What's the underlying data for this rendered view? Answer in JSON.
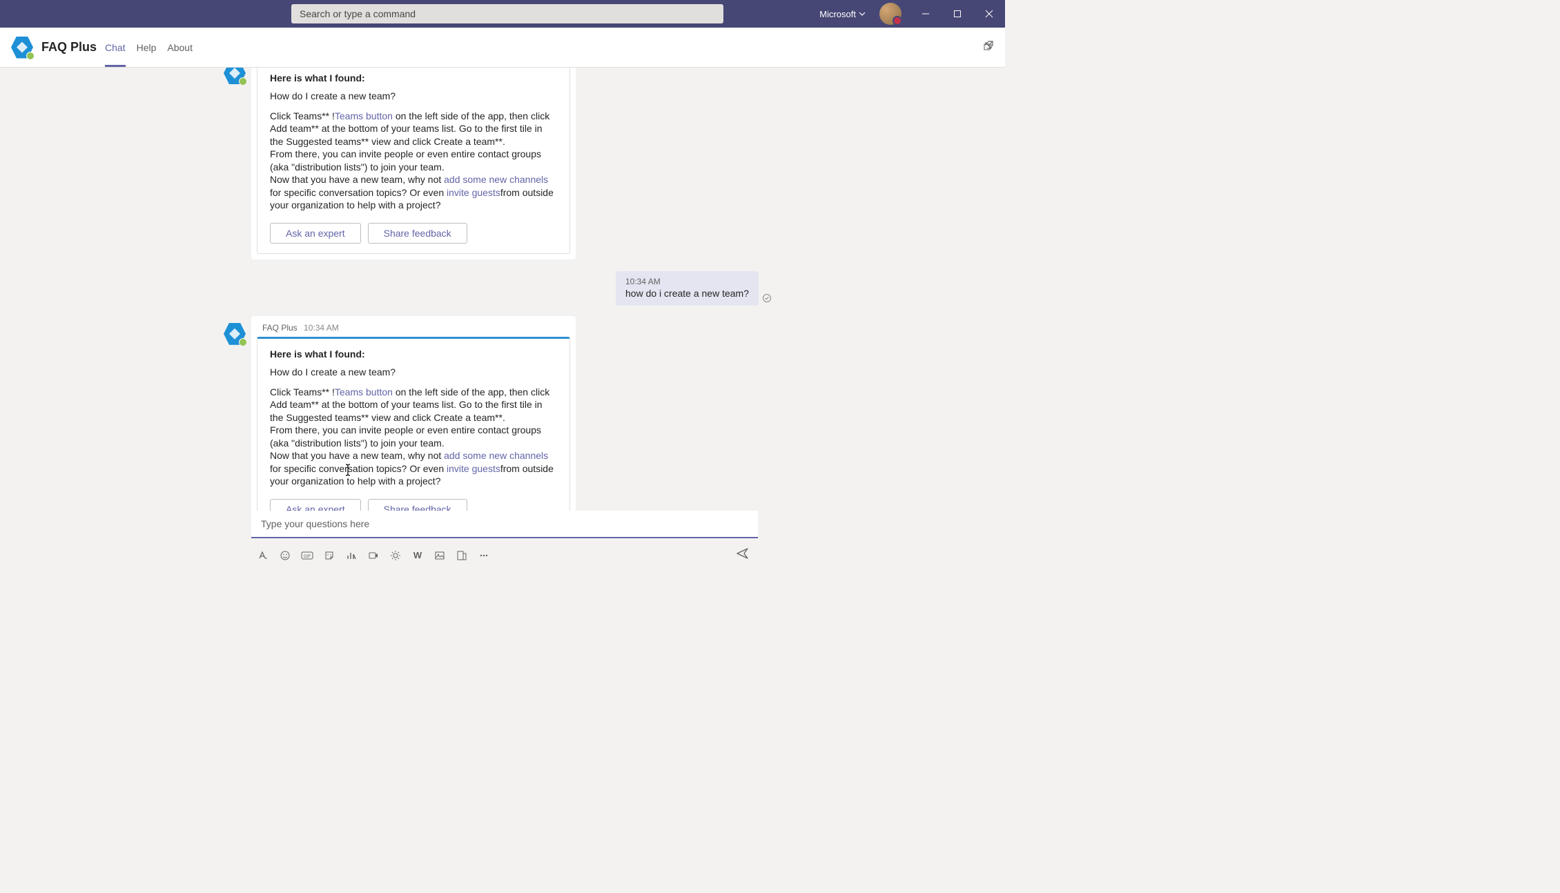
{
  "titlebar": {
    "search_placeholder": "Search or type a command",
    "org": "Microsoft"
  },
  "header": {
    "app_title": "FAQ Plus",
    "tabs": {
      "chat": "Chat",
      "help": "Help",
      "about": "About"
    }
  },
  "messages": {
    "bot_name": "FAQ Plus",
    "bot_time": "10:34 AM",
    "card": {
      "title": "Here is what I found:",
      "question": "How do I create a new team?",
      "body_pre1": "Click Teams** !",
      "link1": "Teams button",
      "body_post1": " on the left side of the app, then click Add team** at the bottom of your teams list. Go to the first tile in the Suggested teams** view and click Create a team**.",
      "body_line2": "From there, you can invite people or even entire contact groups (aka \"distribution lists\") to join your team.",
      "body_pre2": "Now that you have a new team, why not ",
      "link2": "add some new channels",
      "body_post2": " for specific conversation topics? Or even ",
      "link3": "invite guests",
      "body_post3": "from outside your organization to help with a project?",
      "ask_expert": "Ask an expert",
      "share_feedback": "Share feedback"
    },
    "user_time": "10:34 AM",
    "user_text": "how do i create a new team?"
  },
  "composer": {
    "placeholder": "Type your questions here"
  }
}
